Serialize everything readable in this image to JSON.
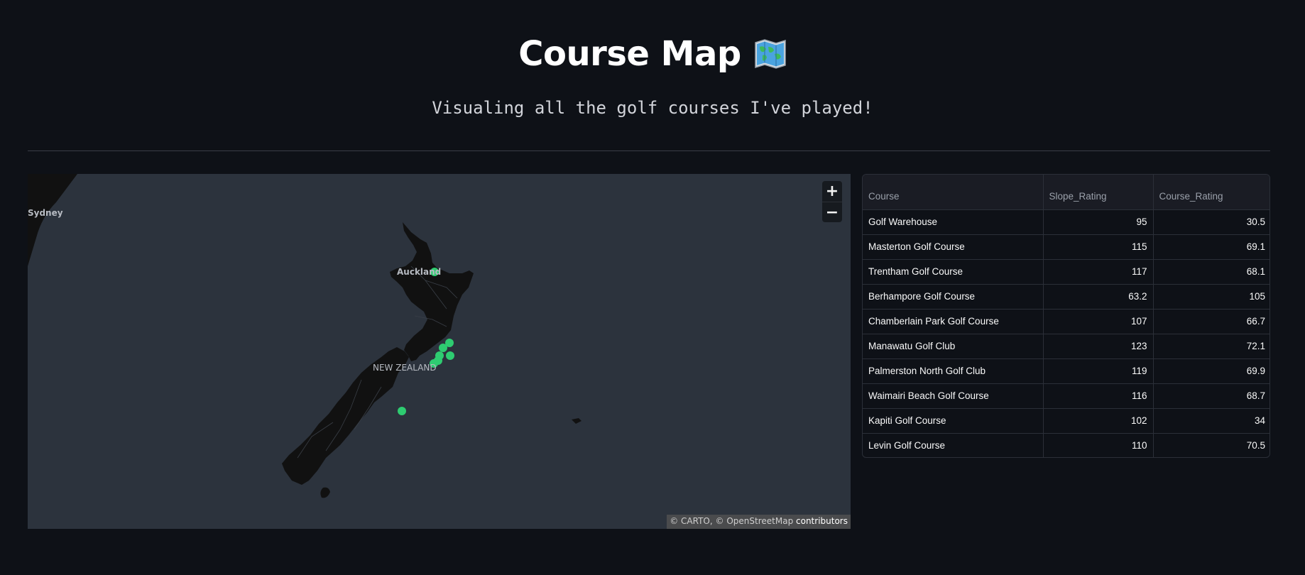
{
  "header": {
    "title": "Course Map",
    "subtitle": "Visualing all the golf courses I've played!"
  },
  "map": {
    "labels": {
      "sydney": "Sydney",
      "auckland": "Auckland",
      "new_zealand": "NEW ZEALAND"
    },
    "zoom_in": "+",
    "zoom_out": "−",
    "attribution": {
      "carto": "© CARTO,",
      "osm": "© OpenStreetMap",
      "contributors": "contributors"
    },
    "marker_color": "#2ecc71",
    "land_color": "#111111",
    "water_color": "#2c333d"
  },
  "table": {
    "columns": [
      "Course",
      "Slope_Rating",
      "Course_Rating"
    ],
    "rows": [
      [
        "Golf Warehouse",
        "95",
        "30.5"
      ],
      [
        "Masterton Golf Course",
        "115",
        "69.1"
      ],
      [
        "Trentham Golf Course",
        "117",
        "68.1"
      ],
      [
        "Berhampore Golf Course",
        "63.2",
        "105"
      ],
      [
        "Chamberlain Park Golf Course",
        "107",
        "66.7"
      ],
      [
        "Manawatu Golf Club",
        "123",
        "72.1"
      ],
      [
        "Palmerston North Golf Club",
        "119",
        "69.9"
      ],
      [
        "Waimairi Beach Golf Course",
        "116",
        "68.7"
      ],
      [
        "Kapiti Golf Course",
        "102",
        "34"
      ],
      [
        "Levin Golf Course",
        "110",
        "70.5"
      ]
    ]
  }
}
